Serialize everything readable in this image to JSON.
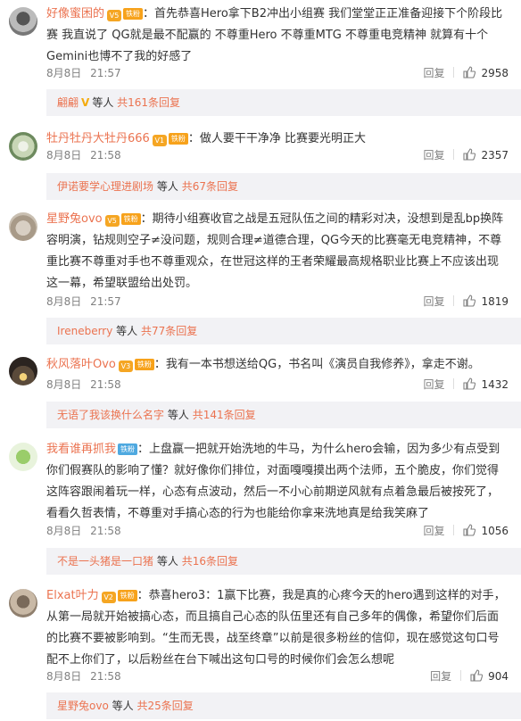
{
  "comments": [
    {
      "username": "好像蜜困的",
      "vip_label": "V5",
      "fan_badge": "铁粉",
      "text": "：首先恭喜Hero拿下B2冲出小组赛 我们堂堂正正准备迎接下个阶段比赛 我直说了 QG就是最不配赢的 不尊重Hero 不尊重MTG 不尊重电竞精神 就算有十个Gemini也博不了我的好感了",
      "date": "8月8日",
      "time": "21:57",
      "reply_label": "回复",
      "likes": "2958",
      "reply_user": "翩翩",
      "reply_user_badge": "V",
      "reply_middle": "等人",
      "reply_total": "共161条回复"
    },
    {
      "username": "牡丹牡丹大牡丹666",
      "vip_label": "V1",
      "fan_badge": "铁粉",
      "text": "：做人要干干净净 比赛要光明正大",
      "date": "8月8日",
      "time": "21:58",
      "reply_label": "回复",
      "likes": "2357",
      "reply_user": "伊诺要学心理进剧场",
      "reply_middle": "等人",
      "reply_total": "共67条回复"
    },
    {
      "username": "星野兔ovo",
      "vip_label": "V5",
      "fan_badge": "铁粉",
      "text": "：期待小组赛收官之战是五冠队伍之间的精彩对决，没想到是乱bp换阵容明演，钻规则空子≠没问题，规则合理≠道德合理，QG今天的比赛毫无电竞精神，不尊重比赛不尊重对手也不尊重观众，在世冠这样的王者荣耀最高规格职业比赛上不应该出现这一幕，希望联盟给出处罚。",
      "date": "8月8日",
      "time": "21:57",
      "reply_label": "回复",
      "likes": "1819",
      "reply_user": "Ireneberry",
      "reply_middle": "等人",
      "reply_total": "共77条回复"
    },
    {
      "username": "秋风落叶Ovo",
      "vip_label": "V3",
      "fan_badge": "铁粉",
      "text": "：我有一本书想送给QG，书名叫《演员自我修养》，拿走不谢。",
      "date": "8月8日",
      "time": "21:58",
      "reply_label": "回复",
      "likes": "1432",
      "reply_user": "无语了我该换什么名字",
      "reply_middle": "等人",
      "reply_total": "共141条回复"
    },
    {
      "username": "我看谁再抓我",
      "fan_badge": "铁粉",
      "text": "：上盘赢一把就开始洗地的牛马，为什么hero会输，因为多少有点受到你们假赛队的影响了懂？就好像你们排位，对面嘎嘎摸出两个法师，五个脆皮，你们觉得这阵容跟闹着玩一样，心态有点波动，然后一不小心前期逆风就有点着急最后被按死了，看看久哲表情，不尊重对手搞心态的行为也能给你拿来洗地真是给我笑麻了",
      "date": "8月8日",
      "time": "21:58",
      "reply_label": "回复",
      "likes": "1056",
      "reply_user": "不是一头猪是一口猪",
      "reply_middle": "等人",
      "reply_total": "共16条回复"
    },
    {
      "username": "Elxat叶力",
      "vip_label": "V2",
      "fan_badge": "铁粉",
      "text": "：恭喜hero3：1赢下比赛，我是真的心疼今天的hero遇到这样的对手，从第一局就开始被搞心态，而且搞自己心态的队伍里还有自己多年的偶像，希望你们后面的比赛不要被影响到。“生而无畏，战至终章”以前是很多粉丝的信仰，现在感觉这句口号配不上你们了，以后粉丝在台下喊出这句口号的时候你们会怎么想呢",
      "date": "8月8日",
      "time": "21:58",
      "reply_label": "回复",
      "likes": "904",
      "reply_user": "星野兔ovo",
      "reply_middle": "等人",
      "reply_total": "共25条回复"
    }
  ],
  "icons": {
    "thumb": "thumbs-up-icon",
    "vip": "vip-crown-icon",
    "emoji": "emoji-icon"
  },
  "colors": {
    "username": "#eb7350",
    "meta": "#808080",
    "reply_bg": "#f2f2f5",
    "fan_badge": "#f7a21b",
    "fan_badge_blue": "#4fa9e0"
  }
}
